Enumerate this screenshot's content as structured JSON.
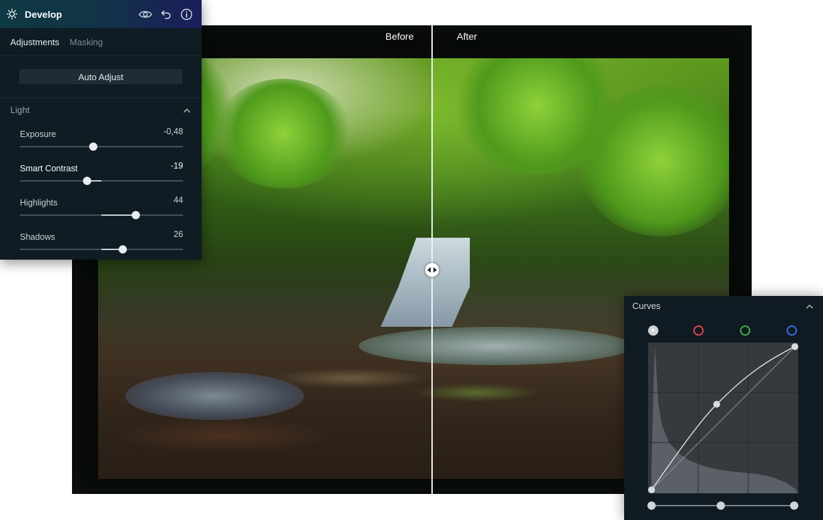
{
  "compare": {
    "before_label": "Before",
    "after_label": "After"
  },
  "develop": {
    "title": "Develop",
    "tabs": [
      {
        "label": "Adjustments",
        "active": true
      },
      {
        "label": "Masking",
        "active": false
      }
    ],
    "auto_adjust_label": "Auto Adjust",
    "section_light": "Light",
    "sliders": [
      {
        "label": "Exposure",
        "value": "-0,48",
        "position": 0.45
      },
      {
        "label": "Smart Contrast",
        "value": "-19",
        "position": 0.41
      },
      {
        "label": "Highlights",
        "value": "44",
        "position": 0.71
      },
      {
        "label": "Shadows",
        "value": "26",
        "position": 0.63
      }
    ]
  },
  "curves": {
    "title": "Curves",
    "channels": [
      {
        "name": "luminance",
        "color": "#d0d0d0"
      },
      {
        "name": "red",
        "color": "#e04848"
      },
      {
        "name": "green",
        "color": "#3fb04c"
      },
      {
        "name": "blue",
        "color": "#3a6fe0"
      }
    ]
  },
  "colors": {
    "panel_bg": "#0f1c24",
    "header_gradient_start": "#0e3843",
    "header_gradient_end": "#1a1e5c",
    "slider_knob": "#e8edf1"
  }
}
